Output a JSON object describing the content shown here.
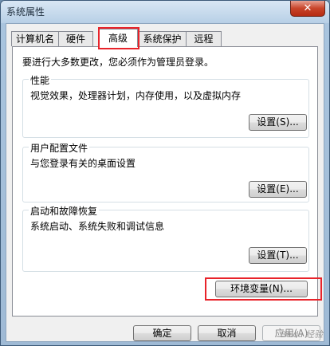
{
  "window": {
    "title": "系统属性",
    "close_glyph": "✕"
  },
  "tabs": [
    {
      "label": "计算机名"
    },
    {
      "label": "硬件"
    },
    {
      "label": "高级"
    },
    {
      "label": "系统保护"
    },
    {
      "label": "远程"
    }
  ],
  "advanced": {
    "notice": "要进行大多数更改，您必须作为管理员登录。",
    "performance": {
      "title": "性能",
      "desc": "视觉效果，处理器计划，内存使用，以及虚拟内存",
      "button": "设置(S)..."
    },
    "user_profiles": {
      "title": "用户配置文件",
      "desc": "与您登录有关的桌面设置",
      "button": "设置(E)..."
    },
    "startup_recovery": {
      "title": "启动和故障恢复",
      "desc": "系统启动、系统失败和调试信息",
      "button": "设置(T)..."
    },
    "env_button": "环境变量(N)..."
  },
  "footer": {
    "ok": "确定",
    "cancel": "取消",
    "apply": "应用(A)"
  },
  "watermark": "Baidu 经验",
  "colors": {
    "highlight_box": "#e8232a"
  }
}
